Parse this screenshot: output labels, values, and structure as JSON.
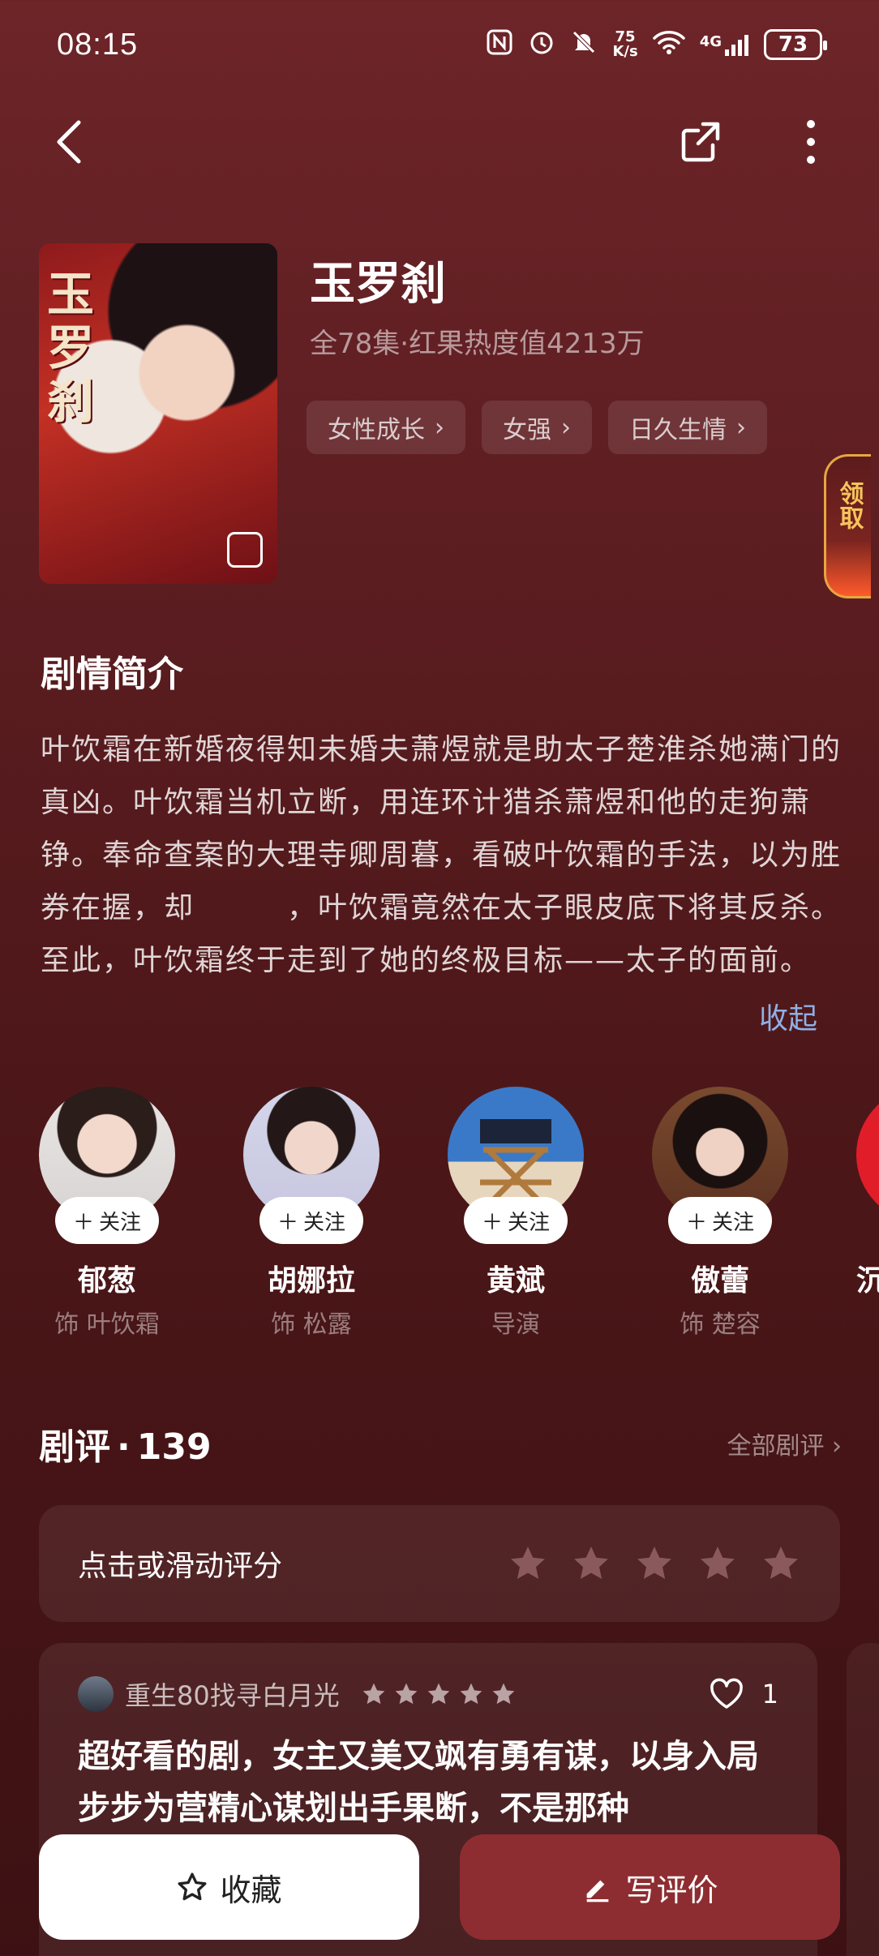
{
  "status_bar": {
    "time": "08:15",
    "net_speed_value": "75",
    "net_speed_unit": "K/s",
    "network": "4G",
    "battery": "73"
  },
  "drama": {
    "cover_title": "玉罗刹",
    "title": "玉罗刹",
    "meta": "全78集·红果热度值4213万",
    "tags": [
      "女性成长",
      "女强",
      "日久生情"
    ]
  },
  "float_claim": {
    "label": "领取"
  },
  "synopsis": {
    "heading": "剧情简介",
    "text": "叶饮霜在新婚夜得知未婚夫萧煜就是助太子楚淮杀她满门的真凶。叶饮霜当机立断，用连环计猎杀萧煜和他的走狗萧铮。奉命查案的大理寺卿周暮，看破叶饮霜的手法，以为胜券在握，却　　　，叶饮霜竟然在太子眼皮底下将其反杀。至此，叶饮霜终于走到了她的终极目标——太子的面前。",
    "collapse_label": "收起"
  },
  "cast": {
    "follow_label": "关注",
    "members": [
      {
        "name": "郁葱",
        "role": "饰 叶饮霜"
      },
      {
        "name": "胡娜拉",
        "role": "饰 松露"
      },
      {
        "name": "黄斌",
        "role": "导演"
      },
      {
        "name": "傲蕾",
        "role": "饰 楚容"
      },
      {
        "name": "沉",
        "role": ""
      }
    ]
  },
  "reviews": {
    "heading": "剧评",
    "count": "139",
    "separator": "·",
    "all_label": "全部剧评",
    "rate_prompt": "点击或滑动评分",
    "rate_value": 0,
    "items": [
      {
        "user": "重生80找寻白月光",
        "stars": 5,
        "likes": "1",
        "text": "超好看的剧，女主又美又飒有勇有谋，以身入局步步为营精心谋划出手果断，不是那种"
      }
    ]
  },
  "bottom_bar": {
    "collect_label": "收藏",
    "review_label": "写评价"
  },
  "colors": {
    "background_top": "#6d2528",
    "background_bottom": "#3d1113",
    "accent_link": "#8fb0e6",
    "review_button": "#8e2d31"
  }
}
